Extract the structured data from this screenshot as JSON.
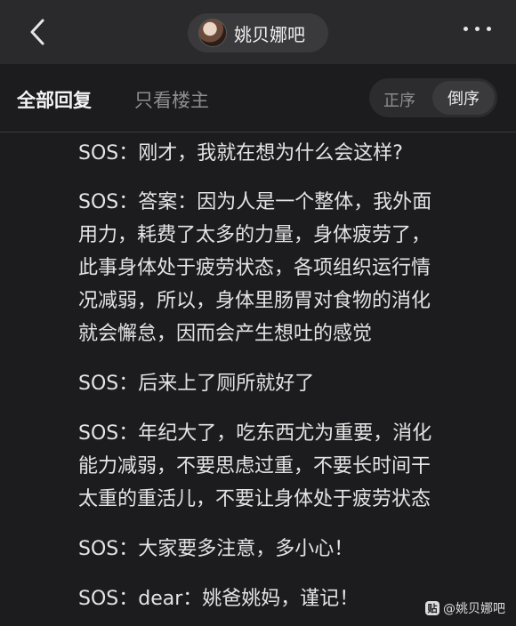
{
  "header": {
    "forum_name": "姚贝娜吧",
    "back_icon": "back-chevron-icon",
    "more_icon": "more-dots-icon"
  },
  "tabs": {
    "all_replies": "全部回复",
    "only_op": "只看楼主",
    "sort_asc": "正序",
    "sort_desc": "倒序",
    "active_sort": "倒序"
  },
  "post": {
    "lines": [
      "SOS：刚才，我就在想为什么会这样?",
      "SOS：答案：因为人是一个整体，我外面",
      "用力，耗费了太多的力量，身体疲劳了，",
      "此事身体处于疲劳状态，各项组织运行情",
      "况减弱，所以，身体里肠胃对食物的消化",
      "就会懈怠，因而会产生想吐的感觉",
      "SOS：后来上了厕所就好了",
      "SOS：年纪大了，吃东西尤为重要，消化",
      "能力减弱，不要思虑过重，不要长时间干",
      "太重的重活儿，不要让身体处于疲劳状态",
      "SOS：大家要多注意，多小心！",
      "SOS：dear：姚爸姚妈，谨记！"
    ]
  },
  "watermark": {
    "icon_char": "贴",
    "text": "@姚贝娜吧"
  }
}
